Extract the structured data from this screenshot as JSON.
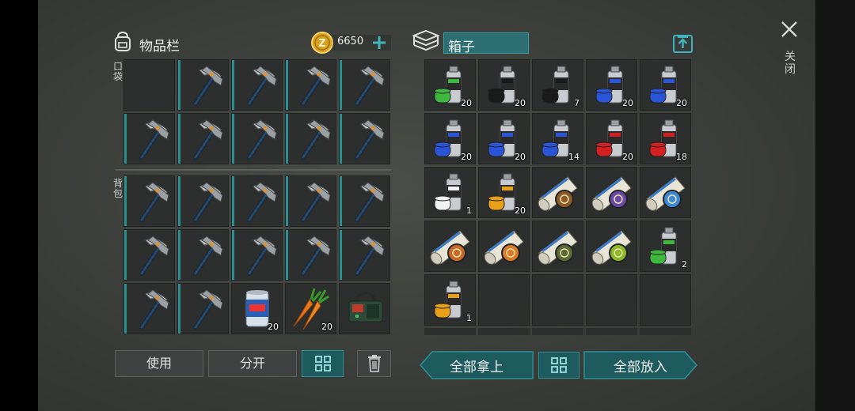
{
  "inventory": {
    "title": "物品栏",
    "coins": "6650",
    "pocket_label": "口袋",
    "backpack_label": "背包",
    "pocket_slots": [
      {
        "item": "empty",
        "count": ""
      },
      {
        "item": "pickaxe-icon",
        "count": ""
      },
      {
        "item": "pickaxe-icon",
        "count": ""
      },
      {
        "item": "pickaxe-icon",
        "count": ""
      },
      {
        "item": "pickaxe-icon",
        "count": ""
      },
      {
        "item": "pickaxe-icon",
        "count": ""
      },
      {
        "item": "pickaxe-icon",
        "count": ""
      },
      {
        "item": "pickaxe-icon",
        "count": ""
      },
      {
        "item": "pickaxe-icon",
        "count": ""
      },
      {
        "item": "pickaxe-icon",
        "count": ""
      }
    ],
    "backpack_slots": [
      {
        "item": "pickaxe-icon",
        "count": ""
      },
      {
        "item": "pickaxe-icon",
        "count": ""
      },
      {
        "item": "pickaxe-icon",
        "count": ""
      },
      {
        "item": "pickaxe-icon",
        "count": ""
      },
      {
        "item": "pickaxe-icon",
        "count": ""
      },
      {
        "item": "pickaxe-icon",
        "count": ""
      },
      {
        "item": "pickaxe-icon",
        "count": ""
      },
      {
        "item": "pickaxe-icon",
        "count": ""
      },
      {
        "item": "pickaxe-icon",
        "count": ""
      },
      {
        "item": "pickaxe-icon",
        "count": ""
      },
      {
        "item": "pickaxe-icon",
        "count": ""
      },
      {
        "item": "pickaxe-icon",
        "count": ""
      },
      {
        "item": "beer-can-icon",
        "count": "20"
      },
      {
        "item": "carrot-icon",
        "count": "20"
      },
      {
        "item": "explosive-charge-icon",
        "count": ""
      }
    ],
    "buttons": {
      "use": "使用",
      "split": "分开"
    }
  },
  "box": {
    "title": "箱子",
    "slots": [
      {
        "item": "spray-paint-icon",
        "color": "#3fb83f",
        "count": "20"
      },
      {
        "item": "spray-paint-icon",
        "color": "#1a1a1a",
        "count": "20"
      },
      {
        "item": "spray-paint-icon",
        "color": "#1a1a1a",
        "count": "7"
      },
      {
        "item": "spray-paint-icon",
        "color": "#2a55d8",
        "count": "20"
      },
      {
        "item": "spray-paint-icon",
        "color": "#2a55d8",
        "count": "20"
      },
      {
        "item": "spray-paint-icon",
        "color": "#2a55d8",
        "count": "20"
      },
      {
        "item": "spray-paint-icon",
        "color": "#2a55d8",
        "count": "20"
      },
      {
        "item": "spray-paint-icon",
        "color": "#2a55d8",
        "count": "14"
      },
      {
        "item": "spray-paint-icon",
        "color": "#d42020",
        "count": "20"
      },
      {
        "item": "spray-paint-icon",
        "color": "#d42020",
        "count": "18"
      },
      {
        "item": "spray-paint-icon",
        "color": "#f2f2f2",
        "count": "1"
      },
      {
        "item": "spray-paint-icon",
        "color": "#e8a018",
        "count": "20"
      },
      {
        "item": "emblem-scroll-icon",
        "color": "#8a5a2a",
        "count": ""
      },
      {
        "item": "emblem-scroll-icon",
        "color": "#6a4aa8",
        "count": ""
      },
      {
        "item": "emblem-scroll-icon",
        "color": "#3a8ad8",
        "count": ""
      },
      {
        "item": "emblem-scroll-icon",
        "color": "#c86a2a",
        "count": ""
      },
      {
        "item": "emblem-scroll-icon",
        "color": "#d87a2a",
        "count": ""
      },
      {
        "item": "emblem-scroll-icon",
        "color": "#5a6a3a",
        "count": ""
      },
      {
        "item": "emblem-scroll-icon",
        "color": "#8ab82a",
        "count": ""
      },
      {
        "item": "spray-paint-icon",
        "color": "#3fb83f",
        "count": "2"
      },
      {
        "item": "spray-paint-icon",
        "color": "#e8a018",
        "count": "1"
      },
      {
        "item": "empty",
        "color": "",
        "count": ""
      },
      {
        "item": "empty",
        "color": "",
        "count": ""
      },
      {
        "item": "empty",
        "color": "",
        "count": ""
      },
      {
        "item": "empty",
        "color": "",
        "count": ""
      }
    ],
    "buttons": {
      "take_all": "全部拿上",
      "put_all": "全部放入"
    }
  },
  "close_label": "关闭",
  "colors": {
    "accent": "#2a8e93",
    "teal_dark": "#1e5b5f",
    "coin": "#e0b030"
  }
}
